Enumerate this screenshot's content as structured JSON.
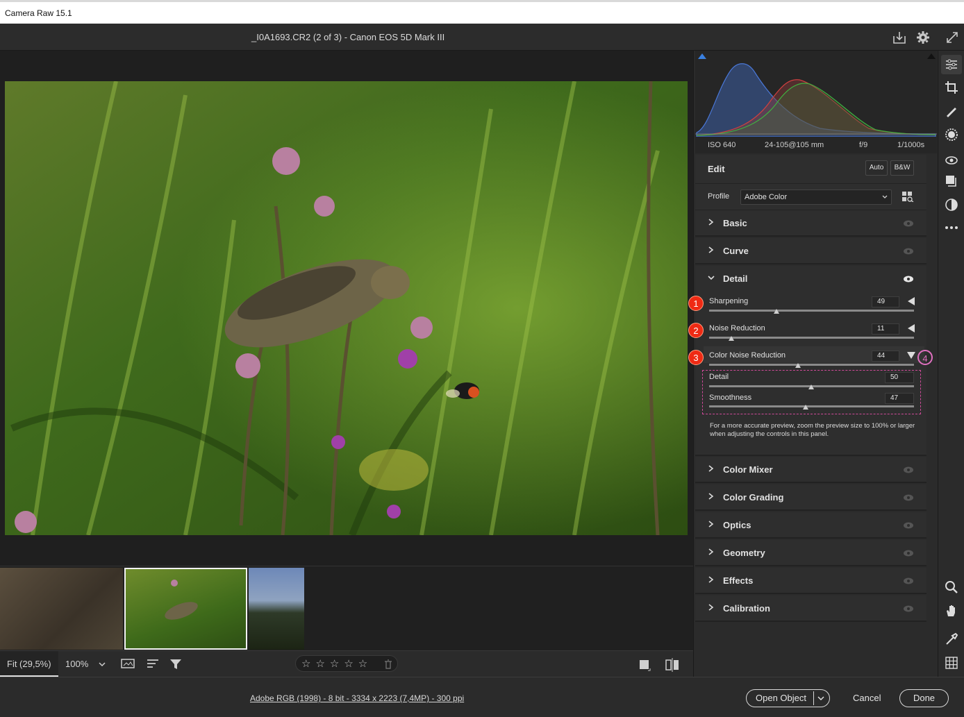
{
  "window": {
    "title": "Camera Raw 15.1"
  },
  "header": {
    "file_info": "_I0A1693.CR2  (2 of 3)   -   Canon EOS 5D Mark III"
  },
  "histogram": {
    "iso": "ISO 640",
    "lens": "24-105@105 mm",
    "aperture": "f/9",
    "shutter": "1/1000s"
  },
  "edit": {
    "title": "Edit",
    "auto_label": "Auto",
    "bw_label": "B&W"
  },
  "profile": {
    "label": "Profile",
    "value": "Adobe Color"
  },
  "sections": {
    "basic": "Basic",
    "curve": "Curve",
    "detail": "Detail",
    "color_mixer": "Color Mixer",
    "color_grading": "Color Grading",
    "optics": "Optics",
    "geometry": "Geometry",
    "effects": "Effects",
    "calibration": "Calibration"
  },
  "detail": {
    "sharpening": {
      "label": "Sharpening",
      "value": "49",
      "level": 0.33
    },
    "noise_reduction": {
      "label": "Noise Reduction",
      "value": "11",
      "level": 0.11
    },
    "color_noise_reduction": {
      "label": "Color Noise Reduction",
      "value": "44",
      "level": 0.44
    },
    "cnr_detail": {
      "label": "Detail",
      "value": "50",
      "level": 0.5
    },
    "cnr_smoothness": {
      "label": "Smoothness",
      "value": "47",
      "level": 0.47
    },
    "hint": "For a more accurate preview, zoom the preview size to 100% or larger when adjusting the controls in this panel.",
    "badges": [
      "1",
      "2",
      "3",
      "4"
    ]
  },
  "preview_bar": {
    "fit_label": "Fit (29,5%)",
    "zoom_label": "100%"
  },
  "footer": {
    "info": "Adobe RGB (1998) - 8 bit - 3334 x 2223 (7,4MP) - 300 ppi",
    "open_object": "Open Object",
    "cancel": "Cancel",
    "done": "Done"
  },
  "colors": {
    "badge_red": "#ef2a14",
    "badge_outline_pink": "#e070c0",
    "highlight_dash": "#d04a9a"
  }
}
